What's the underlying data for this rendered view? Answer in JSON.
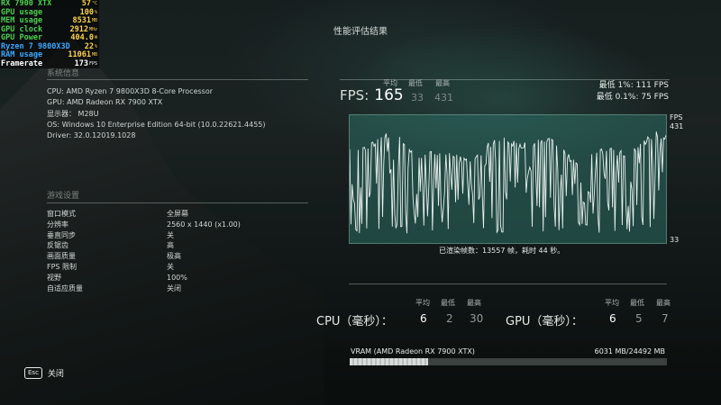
{
  "overlay": {
    "rows": [
      {
        "label": "RX 7900 XTX",
        "value": "57",
        "unit": "°C"
      },
      {
        "label": "GPU usage",
        "value": "100",
        "unit": "%"
      },
      {
        "label": "MEM usage",
        "value": "8531",
        "unit": "MB"
      },
      {
        "label": "GPU clock",
        "value": "2912",
        "unit": "MHz"
      },
      {
        "label": "GPU Power",
        "value": "404.0",
        "unit": "W"
      },
      {
        "label": "Ryzen 7 9800X3D",
        "value": "22",
        "unit": "%"
      },
      {
        "label": "RAM usage",
        "value": "11061",
        "unit": "MB"
      },
      {
        "label": "Framerate",
        "value": "173",
        "unit": "FPS"
      }
    ]
  },
  "title": "性能评估结果",
  "system": {
    "header": "系统信息",
    "lines": [
      "CPU: AMD Ryzen 7 9800X3D 8-Core Processor",
      "GPU: AMD Radeon RX 7900 XTX",
      "显示器： M28U",
      "OS: Windows 10 Enterprise Edition 64-bit (10.0.22621.4455)",
      "Driver: 32.0.12019.1028"
    ]
  },
  "settings": {
    "header": "游戏设置",
    "rows": [
      {
        "label": "窗口模式",
        "value": "全屏幕"
      },
      {
        "label": "分辨率",
        "value": "2560 x 1440 (x1.00)"
      },
      {
        "label": "垂直同步",
        "value": "关"
      },
      {
        "label": "反锯齿",
        "value": "高"
      },
      {
        "label": "画面质量",
        "value": "极高"
      },
      {
        "label": "FPS 限制",
        "value": "关"
      },
      {
        "label": "视野",
        "value": "100%"
      },
      {
        "label": "自适应质量",
        "value": "关闭"
      }
    ]
  },
  "fps": {
    "label": "FPS:",
    "avg": "165",
    "min": "33",
    "max": "431",
    "col_avg": "平均",
    "col_min": "最低",
    "col_max": "最高",
    "low1_label": "最低 1%:",
    "low1_value": "111 FPS",
    "low01_label": "最低 0.1%:",
    "low01_value": "75 FPS"
  },
  "graph": {
    "axis_unit": "FPS",
    "axis_max": "431",
    "axis_min": "33",
    "caption": "已渲染帧数：13557 帧，耗时 44 秒。"
  },
  "cpu": {
    "label": "CPU（毫秒）：",
    "avg": "6",
    "min": "2",
    "max": "30",
    "col_avg": "平均",
    "col_min": "最低",
    "col_max": "最高"
  },
  "gpu": {
    "label": "GPU（毫秒）：",
    "avg": "6",
    "min": "5",
    "max": "7",
    "col_avg": "平均",
    "col_min": "最低",
    "col_max": "最高"
  },
  "vram": {
    "label": "VRAM (AMD Radeon RX 7900 XTX)",
    "value": "6031 MB/24492 MB",
    "fraction": 0.246
  },
  "footer": {
    "key": "Esc",
    "label": "关闭"
  },
  "colors": {
    "osd_value": "#ffd34a",
    "osd_gpu": "#4cd14c",
    "osd_cpu": "#3aa9ff",
    "graph_bg": "#2d6e64"
  }
}
